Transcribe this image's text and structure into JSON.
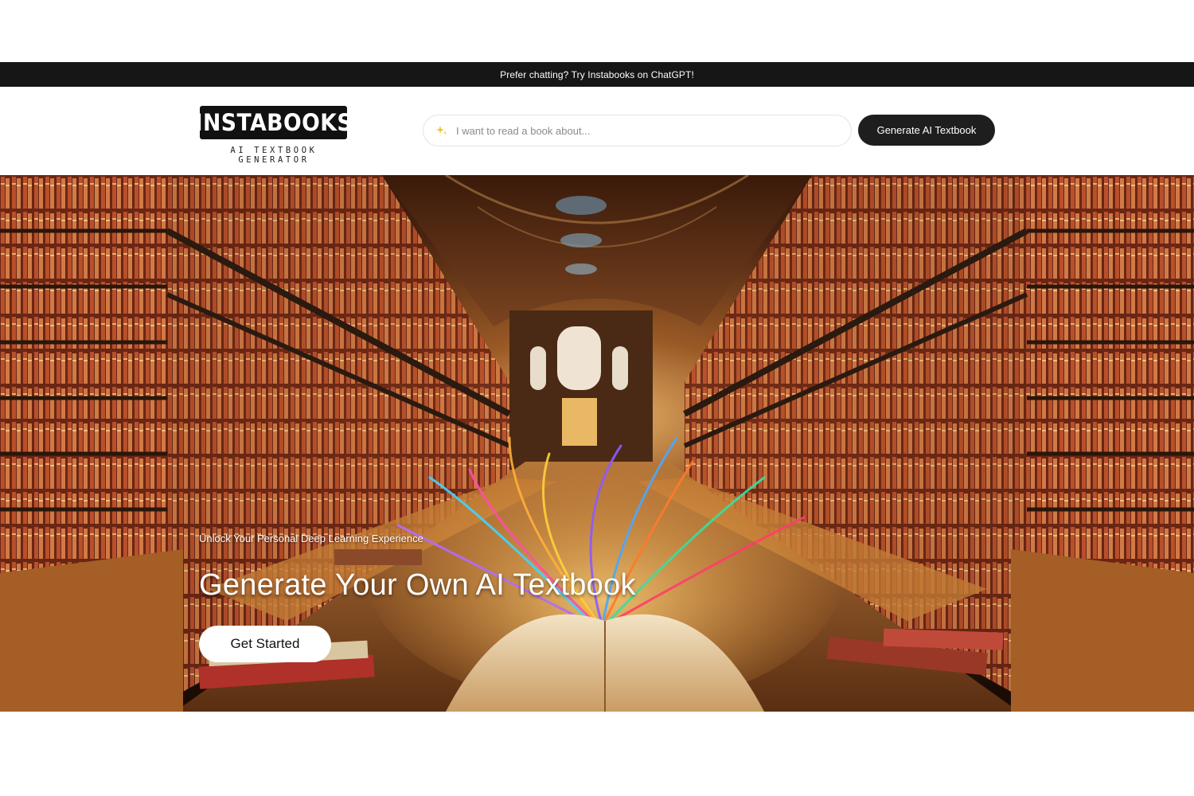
{
  "announcement": {
    "text": "Prefer chatting? Try Instabooks on ChatGPT!"
  },
  "header": {
    "logo_title": "INSTABOOKS",
    "logo_subtitle": "AI TEXTBOOK GENERATOR",
    "search_placeholder": "I want to read a book about...",
    "search_icon": "sparkle-icon",
    "generate_button_label": "Generate AI Textbook"
  },
  "hero": {
    "tagline": "Unlock Your Personal Deep Learning Experience",
    "headline": "Generate Your Own AI Textbook",
    "cta_label": "Get Started",
    "image": "library-hall-with-glowing-open-book"
  },
  "colors": {
    "announcement_bg": "#161616",
    "button_dark": "#1e1e1e",
    "cta_bg": "#ffffff",
    "accent_spark": "#f2c230"
  }
}
